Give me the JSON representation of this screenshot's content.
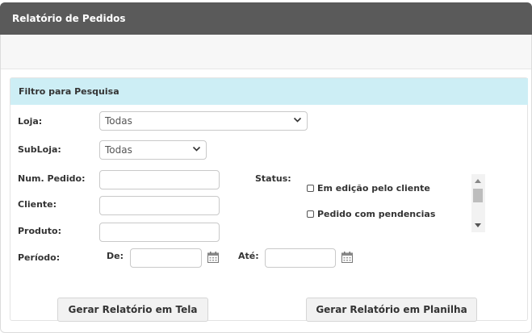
{
  "header": {
    "title": "Relatório de Pedidos"
  },
  "filter": {
    "title": "Filtro para Pesquisa",
    "loja": {
      "label": "Loja:",
      "value": "Todas"
    },
    "subloja": {
      "label": "SubLoja:",
      "value": "Todas"
    },
    "num_pedido": {
      "label": "Num. Pedido:",
      "value": ""
    },
    "cliente": {
      "label": "Cliente:",
      "value": ""
    },
    "produto": {
      "label": "Produto:",
      "value": ""
    },
    "periodo": {
      "label": "Período:",
      "de_label": "De:",
      "ate_label": "Até:",
      "de_value": "",
      "ate_value": ""
    },
    "status": {
      "label": "Status:",
      "options": [
        {
          "label": "Em edição pelo cliente",
          "checked": false
        },
        {
          "label": "Pedido com pendencias",
          "checked": false
        }
      ]
    }
  },
  "actions": {
    "screen_report": "Gerar Relatório em Tela",
    "spreadsheet_report": "Gerar Relatório em Planilha"
  },
  "icons": {
    "calendar": "calendar-icon",
    "dropdown": "chevron-down-icon"
  }
}
